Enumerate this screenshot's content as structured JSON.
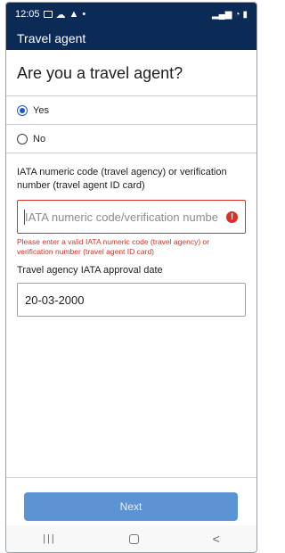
{
  "status_bar": {
    "time": "12:05",
    "right_icons": "signal-wifi-battery"
  },
  "app_bar": {
    "title": "Travel agent"
  },
  "question": {
    "heading": "Are you a travel agent?"
  },
  "options": [
    {
      "label": "Yes",
      "selected": true
    },
    {
      "label": "No",
      "selected": false
    }
  ],
  "iata_field": {
    "label": "IATA numeric code (travel agency) or verification number (travel agent ID card)",
    "placeholder": "IATA numeric code/verification numbe",
    "value": "",
    "error_icon": "!",
    "error": "Please enter a valid IATA numeric code (travel agency) or verification number (travel agent ID card)"
  },
  "date_field": {
    "label": "Travel agency IATA approval date",
    "value": "20-03-2000"
  },
  "actions": {
    "next_label": "Next"
  },
  "nav": {
    "recent": "|||",
    "back": "<"
  },
  "colors": {
    "header": "#0b2a55",
    "error": "#d93025",
    "button": "#5b93d3",
    "radio": "#1a56c5"
  }
}
